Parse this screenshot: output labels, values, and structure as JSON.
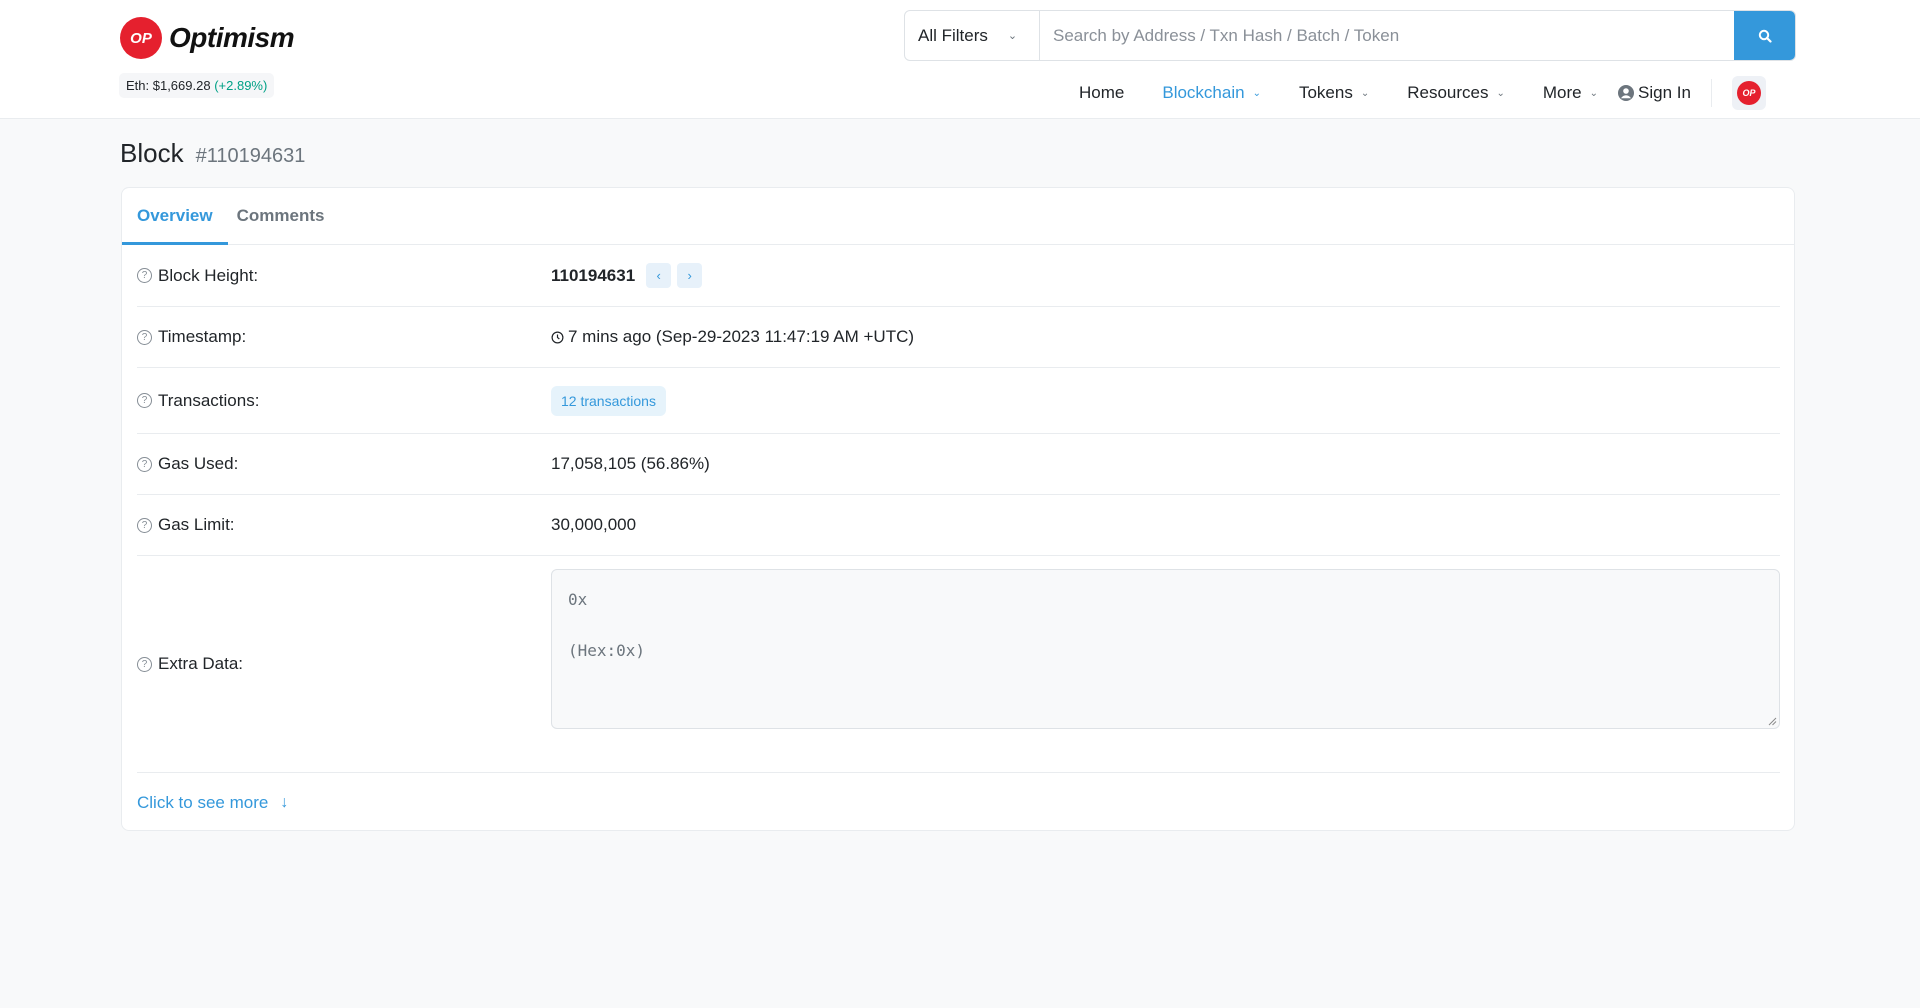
{
  "brand": {
    "logo_mark": "OP",
    "name": "Optimism",
    "accent": "#3498db",
    "brand_red": "#e5202e"
  },
  "eth_price": {
    "label": "Eth: $1,669.28",
    "change": "(+2.89%)"
  },
  "search": {
    "filter_label": "All Filters",
    "placeholder": "Search by Address / Txn Hash / Batch / Token",
    "value": ""
  },
  "nav": {
    "items": [
      {
        "label": "Home",
        "active": false
      },
      {
        "label": "Blockchain",
        "active": true
      },
      {
        "label": "Tokens",
        "active": false
      },
      {
        "label": "Resources",
        "active": false
      },
      {
        "label": "More",
        "active": false
      }
    ],
    "sign_in": "Sign In",
    "network_badge": "OP"
  },
  "page": {
    "title": "Block",
    "block_number": "#110194631"
  },
  "tabs": [
    {
      "label": "Overview",
      "active": true
    },
    {
      "label": "Comments",
      "active": false
    }
  ],
  "details": {
    "block_height": {
      "label": "Block Height:",
      "value": "110194631"
    },
    "timestamp": {
      "label": "Timestamp:",
      "value": "7 mins ago (Sep-29-2023 11:47:19 AM +UTC)"
    },
    "transactions": {
      "label": "Transactions:",
      "value": "12 transactions"
    },
    "gas_used": {
      "label": "Gas Used:",
      "value": "17,058,105 (56.86%)"
    },
    "gas_limit": {
      "label": "Gas Limit:",
      "value": "30,000,000"
    },
    "extra_data": {
      "label": "Extra Data:",
      "line1": "0x",
      "line2": "(Hex:0x)"
    }
  },
  "see_more": "Click to see more"
}
